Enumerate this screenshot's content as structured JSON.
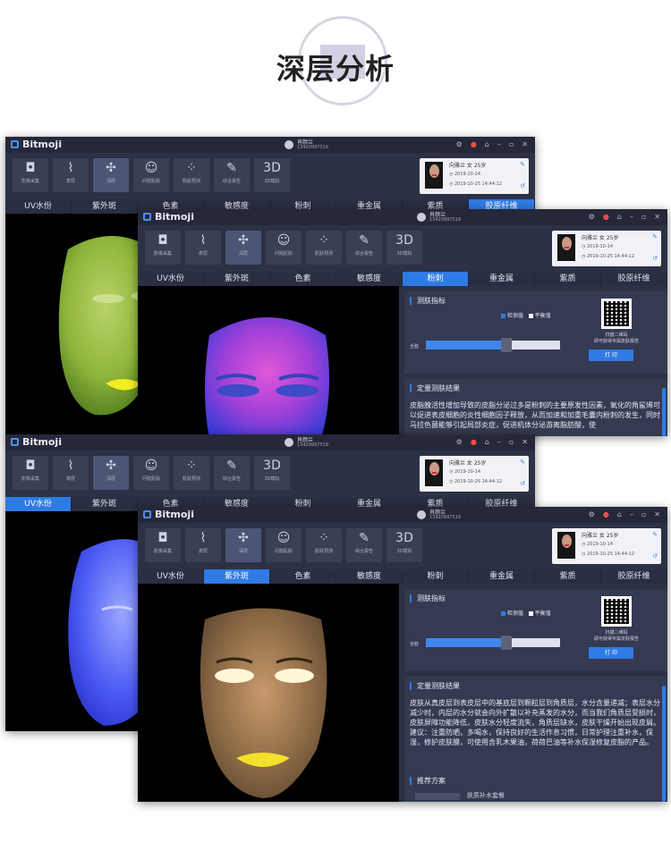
{
  "page": {
    "title": "深层分析"
  },
  "app": {
    "brand": "Bitmoji",
    "user_name": "肖颜兰",
    "user_phone": "13420997519"
  },
  "toolbar": {
    "items": [
      {
        "icon": "camera-icon",
        "glyph": "◘",
        "label": "影像采集"
      },
      {
        "icon": "chart-icon",
        "glyph": "⌇",
        "label": "表层"
      },
      {
        "icon": "molecule-icon",
        "glyph": "✣",
        "label": "深层"
      },
      {
        "icon": "face-icon",
        "glyph": "☺",
        "label": "问题肌肤"
      },
      {
        "icon": "dots-icon",
        "glyph": "⁘",
        "label": "肌肤预测"
      },
      {
        "icon": "report-icon",
        "glyph": "✎",
        "label": "综合报告"
      },
      {
        "icon": "3d-icon",
        "glyph": "3D",
        "label": "3D模拟"
      }
    ]
  },
  "profile": {
    "name_line": "向雅兰  女  25岁",
    "date1": "2019-10-14",
    "date2": "2019-10-25 14:44:12"
  },
  "tabs": [
    "UV水份",
    "紫外斑",
    "色素",
    "敏感度",
    "粉刺",
    "重金属",
    "紫质",
    "胶原纤维"
  ],
  "panel": {
    "indicator_title": "测肤指标",
    "legend_detect": "检测值",
    "legend_balance": "平衡值",
    "slider_label": "全脸",
    "slider_value": 0.58,
    "qr_caption_1": "扫描二维码",
    "qr_caption_2": "即可获得专属皮肤报告",
    "print_label": "打 印",
    "result_title": "定量测肤结果",
    "recommend_title": "推荐方案"
  },
  "window2": {
    "active_tab": "粉刺",
    "result_text": "皮脂腺活性增加导致的皮脂分泌过多是粉刺的主要原发性因素，氧化的角鲨烯可以促进表皮细胞的炎性细胞因子释放，从而加速和加重毛囊内粉刺的发生，同时马拉色菌能够引起局部炎症，促进机体分泌游离脂肪酸，使"
  },
  "window4": {
    "active_tab": "紫外斑",
    "result_text": "皮肤从真皮层到表皮层中的基底层到颗粒层到角质层，水分含量递减；表层水分减少时，内层的水分就会向外扩散以补充蒸发的水分，而当我们角质层受损时，皮肤屏障功能降低，皮肤水分轻度流失，角质层缺水，皮肤干燥开始出现皮屑。建议：注重防晒，多喝水，保持良好的生活作息习惯，日常护理注重补水，保湿，修护皮肤膜，可使用含乳木果油，荷荷巴油等补水保湿修复皮脂的产品。",
    "recommend_item": "肤质补水套餐"
  },
  "window1": {
    "active_tab": "胶原纤维"
  },
  "window3": {
    "active_tab": "UV水份"
  },
  "colors": {
    "accent": "#2f7be5",
    "window_bg": "#2d3146",
    "panel_bg": "#353a52"
  }
}
